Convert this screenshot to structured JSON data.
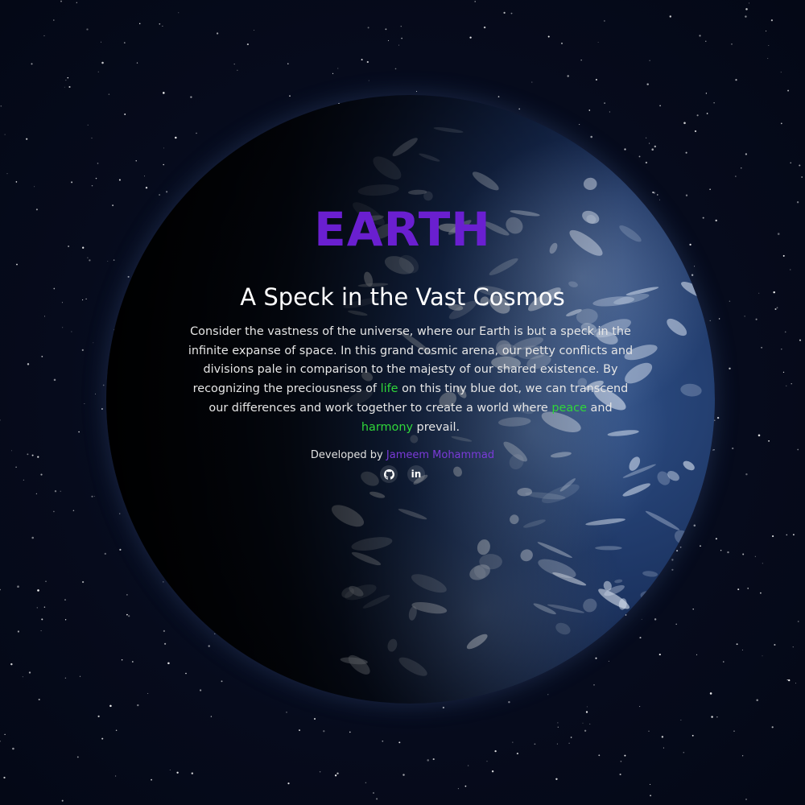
{
  "hero": {
    "title": "EARTH",
    "subtitle": "A Speck in the Vast Cosmos",
    "paragraph": {
      "part1": "Consider the vastness of the universe, where our Earth is but a speck in the infinite expanse of space. In this grand cosmic arena, our petty conflicts and divisions pale in comparison to the majesty of our shared existence. By recognizing the preciousness of ",
      "highlight1": "life",
      "part2": " on this tiny blue dot, we can transcend our differences and work together to create a world where ",
      "highlight2": "peace",
      "part3": " and ",
      "highlight3": "harmony",
      "part4": " prevail."
    }
  },
  "footer": {
    "credit_prefix": "Developed by ",
    "author": "Jameem Mohammad",
    "socials": [
      {
        "name": "github",
        "icon": "github-icon"
      },
      {
        "name": "linkedin",
        "icon": "linkedin-icon",
        "label": "in"
      }
    ]
  },
  "colors": {
    "title": "#6a1fd0",
    "author": "#7a3ad8",
    "highlight": "#2fd63a",
    "background": "#060b1c"
  }
}
